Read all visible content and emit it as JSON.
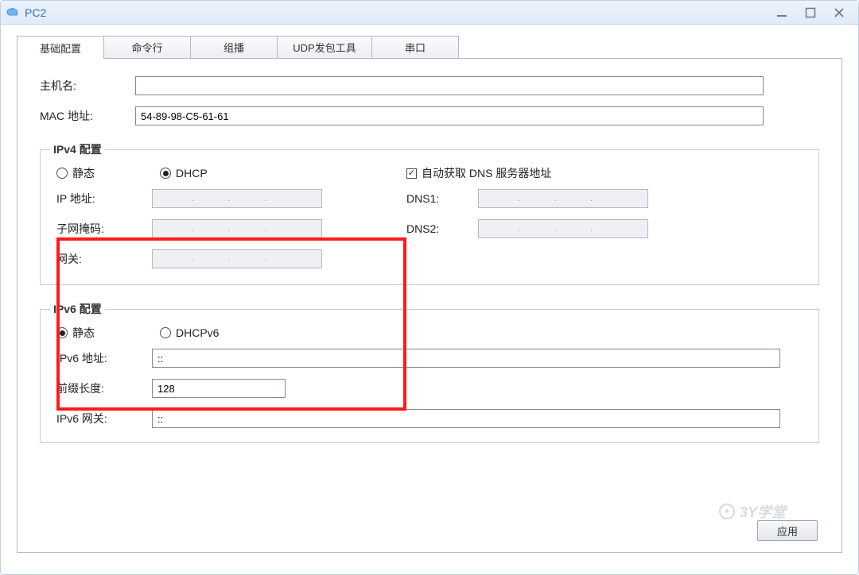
{
  "window": {
    "title": "PC2"
  },
  "tabs": {
    "basic": "基础配置",
    "cli": "命令行",
    "mcast": "组播",
    "udp": "UDP发包工具",
    "serial": "串口"
  },
  "host": {
    "name_label": "主机名:",
    "name_value": "",
    "mac_label": "MAC 地址:",
    "mac_value": "54-89-98-C5-61-61"
  },
  "ipv4": {
    "legend": "IPv4 配置",
    "radio_static": "静态",
    "radio_dhcp": "DHCP",
    "auto_dns": "自动获取 DNS 服务器地址",
    "ip_label": "IP 地址:",
    "mask_label": "子网掩码:",
    "gw_label": "网关:",
    "dns1_label": "DNS1:",
    "dns2_label": "DNS2:",
    "dots": ". . ."
  },
  "ipv6": {
    "legend": "IPv6 配置",
    "radio_static": "静态",
    "radio_dhcp": "DHCPv6",
    "addr_label": "IPv6 地址:",
    "addr_value": "::",
    "prefix_label": "前缀长度:",
    "prefix_value": "128",
    "gw_label": "IPv6 网关:",
    "gw_value": "::"
  },
  "footer": {
    "apply": "应用",
    "watermark": "3Y学堂"
  }
}
